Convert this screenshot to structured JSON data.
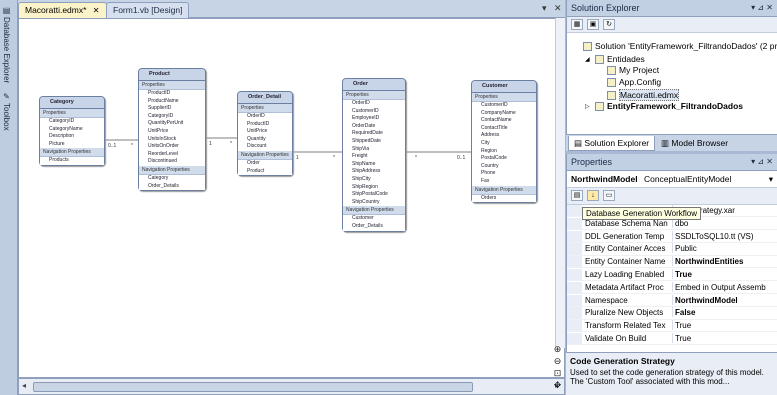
{
  "sidebar": {
    "tabs": [
      "Database Explorer",
      "Toolbox"
    ]
  },
  "doc_tabs": [
    {
      "label": "Macoratti.edmx*",
      "active": true
    },
    {
      "label": "Form1.vb [Design]",
      "active": false
    }
  ],
  "designer": {
    "entities": [
      {
        "title": "Category",
        "sections": [
          "Properties",
          "Navigation Properties"
        ],
        "properties": [
          "CategoryID",
          "CategoryName",
          "Description",
          "Picture"
        ],
        "navigation": [
          "Products"
        ]
      },
      {
        "title": "Product",
        "sections": [
          "Properties",
          "Navigation Properties"
        ],
        "properties": [
          "ProductID",
          "ProductName",
          "SupplierID",
          "CategoryID",
          "QuantityPerUnit",
          "UnitPrice",
          "UnitsInStock",
          "UnitsOnOrder",
          "ReorderLevel",
          "Discontinued"
        ],
        "navigation": [
          "Category",
          "Order_Details"
        ]
      },
      {
        "title": "Order_Detail",
        "sections": [
          "Properties",
          "Navigation Properties"
        ],
        "properties": [
          "OrderID",
          "ProductID",
          "UnitPrice",
          "Quantity",
          "Discount"
        ],
        "navigation": [
          "Order",
          "Product"
        ]
      },
      {
        "title": "Order",
        "sections": [
          "Properties",
          "Navigation Properties"
        ],
        "properties": [
          "OrderID",
          "CustomerID",
          "EmployeeID",
          "OrderDate",
          "RequiredDate",
          "ShippedDate",
          "ShipVia",
          "Freight",
          "ShipName",
          "ShipAddress",
          "ShipCity",
          "ShipRegion",
          "ShipPostalCode",
          "ShipCountry"
        ],
        "navigation": [
          "Customer",
          "Order_Details"
        ]
      },
      {
        "title": "Customer",
        "sections": [
          "Properties",
          "Navigation Properties"
        ],
        "properties": [
          "CustomerID",
          "CompanyName",
          "ContactName",
          "ContactTitle",
          "Address",
          "City",
          "Region",
          "PostalCode",
          "Country",
          "Phone",
          "Fax"
        ],
        "navigation": [
          "Orders"
        ]
      }
    ],
    "multiplicities": [
      "0..1",
      "*",
      "1",
      "*",
      "1",
      "*",
      "*",
      "0..1"
    ]
  },
  "zoom_controls": [
    "⊕",
    "⊖",
    "⊡",
    "✥"
  ],
  "solution_explorer": {
    "title": "Solution Explorer",
    "items": [
      {
        "label": "Solution 'EntityFramework_FiltrandoDados' (2 projects)",
        "indent": 0,
        "bold": false
      },
      {
        "label": "Entidades",
        "indent": 1,
        "bold": false
      },
      {
        "label": "My Project",
        "indent": 2,
        "bold": false
      },
      {
        "label": "App.Config",
        "indent": 2,
        "bold": false
      },
      {
        "label": "Macoratti.edmx",
        "indent": 2,
        "bold": false
      },
      {
        "label": "EntityFramework_FiltrandoDados",
        "indent": 1,
        "bold": true
      }
    ],
    "tabs": [
      "Solution Explorer",
      "Model Browser"
    ]
  },
  "properties": {
    "title": "Properties",
    "object_name": "NorthwindModel",
    "object_type": "ConceptualEntityModel",
    "rows": [
      {
        "name": "Code Generation Strategy",
        "value": "TypeStrategy.xar",
        "bold": false
      },
      {
        "name": "Database Schema Nan",
        "value": "dbo",
        "bold": false
      },
      {
        "name": "DDL Generation Temp",
        "value": "SSDLToSQL10.tt (VS)",
        "bold": false
      },
      {
        "name": "Entity Container Acces",
        "value": "Public",
        "bold": false
      },
      {
        "name": "Entity Container Name",
        "value": "NorthwindEntities",
        "bold": true
      },
      {
        "name": "Lazy Loading Enabled",
        "value": "True",
        "bold": true
      },
      {
        "name": "Metadata Artifact Proc",
        "value": "Embed in Output Assemb",
        "bold": false
      },
      {
        "name": "Namespace",
        "value": "NorthwindModel",
        "bold": true
      },
      {
        "name": "Pluralize New Objects",
        "value": "False",
        "bold": true
      },
      {
        "name": "Transform Related Tex",
        "value": "True",
        "bold": false
      },
      {
        "name": "Validate On Build",
        "value": "True",
        "bold": false
      }
    ],
    "tooltip": "Database Generation Workflow",
    "description": {
      "title": "Code Generation Strategy",
      "text": "Used to set the code generation strategy of this model. The 'Custom Tool' associated with this mod..."
    }
  }
}
